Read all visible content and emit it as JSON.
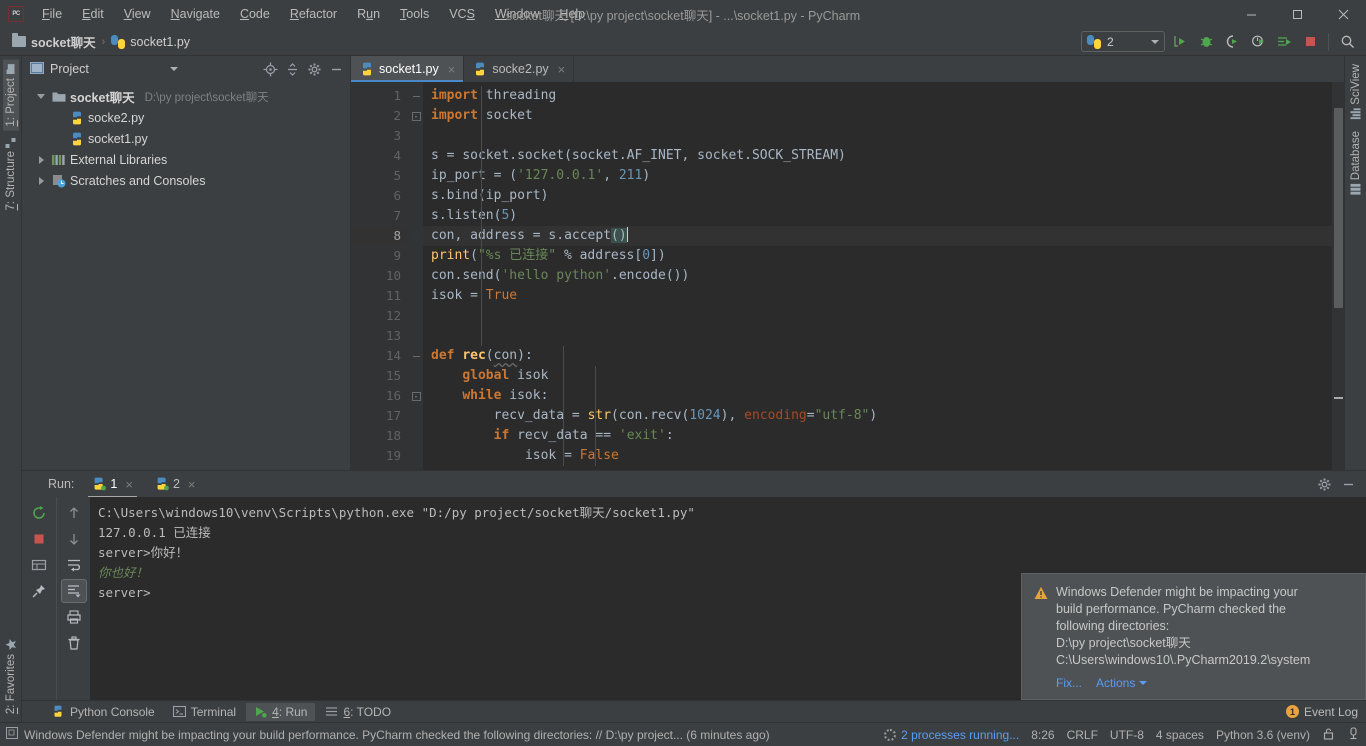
{
  "window": {
    "title": "socket聊天 [D:\\py project\\socket聊天] - ...\\socket1.py - PyCharm",
    "logo_text": "PC",
    "minimize": "—",
    "maximize": "❐",
    "close": "✕"
  },
  "menubar": {
    "items": [
      {
        "label": "File",
        "mnemonic": "F"
      },
      {
        "label": "Edit",
        "mnemonic": "E"
      },
      {
        "label": "View",
        "mnemonic": "V"
      },
      {
        "label": "Navigate",
        "mnemonic": "N"
      },
      {
        "label": "Code",
        "mnemonic": "C"
      },
      {
        "label": "Refactor",
        "mnemonic": "R"
      },
      {
        "label": "Run",
        "mnemonic": "u"
      },
      {
        "label": "Tools",
        "mnemonic": "T"
      },
      {
        "label": "VCS",
        "mnemonic": "S"
      },
      {
        "label": "Window",
        "mnemonic": "W"
      },
      {
        "label": "Help",
        "mnemonic": "H"
      }
    ]
  },
  "breadcrumb": {
    "project": "socket聊天",
    "separator": "›",
    "file": "socket1.py"
  },
  "toolbar": {
    "run_config": "2",
    "icons": [
      {
        "name": "run-icon",
        "glyph": "▶"
      },
      {
        "name": "debug-icon",
        "glyph": "🐞"
      },
      {
        "name": "coverage-icon",
        "glyph": "◗"
      },
      {
        "name": "profile-icon",
        "glyph": "◔"
      },
      {
        "name": "attach-icon",
        "glyph": "≡"
      },
      {
        "name": "stop-icon",
        "glyph": "■"
      },
      {
        "name": "search-icon",
        "glyph": "🔍"
      }
    ]
  },
  "left_strip": {
    "top": [
      {
        "label": "1: Project",
        "mnemonic": "1",
        "active": true
      },
      {
        "label": "7: Structure",
        "mnemonic": "7",
        "active": false
      }
    ],
    "bottom": [
      {
        "label": "2: Favorites",
        "mnemonic": "2",
        "active": false
      }
    ]
  },
  "right_strip": {
    "items": [
      {
        "label": "SciView"
      },
      {
        "label": "Database"
      }
    ]
  },
  "project_panel": {
    "title": "Project",
    "header_icons": [
      {
        "name": "locate-icon",
        "glyph": "⊕"
      },
      {
        "name": "collapse-all-icon",
        "glyph": "⇅"
      },
      {
        "name": "settings-gear-icon",
        "glyph": "✷"
      },
      {
        "name": "hide-panel-icon",
        "glyph": "—"
      }
    ],
    "tree": [
      {
        "label": "socket聊天",
        "path": "D:\\py project\\socket聊天",
        "icon": "folder-icon",
        "expanded": true,
        "depth": 0,
        "bold": true
      },
      {
        "label": "socke2.py",
        "path": "",
        "icon": "python-file-icon",
        "expanded": null,
        "depth": 1,
        "bold": false
      },
      {
        "label": "socket1.py",
        "path": "",
        "icon": "python-file-icon",
        "expanded": null,
        "depth": 1,
        "bold": false
      },
      {
        "label": "External Libraries",
        "path": "",
        "icon": "library-icon",
        "expanded": false,
        "depth": 0,
        "bold": false
      },
      {
        "label": "Scratches and Consoles",
        "path": "",
        "icon": "scratches-icon",
        "expanded": false,
        "depth": 0,
        "bold": false
      }
    ]
  },
  "editor": {
    "tabs": [
      {
        "label": "socket1.py",
        "active": true,
        "icon": "python-file-icon"
      },
      {
        "label": "socke2.py",
        "active": false,
        "icon": "python-file-icon"
      }
    ],
    "current_line": 8,
    "lines": [
      {
        "n": 1,
        "text": "import threading"
      },
      {
        "n": 2,
        "text": "import socket"
      },
      {
        "n": 3,
        "text": ""
      },
      {
        "n": 4,
        "text": "s = socket.socket(socket.AF_INET, socket.SOCK_STREAM)"
      },
      {
        "n": 5,
        "text": "ip_port = ('127.0.0.1', 211)"
      },
      {
        "n": 6,
        "text": "s.bind(ip_port)"
      },
      {
        "n": 7,
        "text": "s.listen(5)"
      },
      {
        "n": 8,
        "text": "con, address = s.accept()"
      },
      {
        "n": 9,
        "text": "print(\"%s 已连接\" % address[0])"
      },
      {
        "n": 10,
        "text": "con.send('hello python'.encode())"
      },
      {
        "n": 11,
        "text": "isok = True"
      },
      {
        "n": 12,
        "text": ""
      },
      {
        "n": 13,
        "text": ""
      },
      {
        "n": 14,
        "text": "def rec(con):"
      },
      {
        "n": 15,
        "text": "    global isok"
      },
      {
        "n": 16,
        "text": "    while isok:"
      },
      {
        "n": 17,
        "text": "        recv_data = str(con.recv(1024), encoding=\"utf-8\")"
      },
      {
        "n": 18,
        "text": "        if recv_data == 'exit':"
      },
      {
        "n": 19,
        "text": "            isok = False"
      }
    ]
  },
  "run_panel": {
    "label": "Run:",
    "tabs": [
      {
        "label": "1",
        "active": true,
        "icon": "python-run-icon"
      },
      {
        "label": "2",
        "active": false,
        "icon": "python-run-icon"
      }
    ],
    "header_icons": [
      {
        "name": "settings-gear-icon",
        "glyph": "✷"
      },
      {
        "name": "hide-panel-icon",
        "glyph": "—"
      }
    ],
    "tools_left": [
      {
        "name": "rerun-icon",
        "glyph": "⟳"
      },
      {
        "name": "stop-icon",
        "glyph": "■"
      },
      {
        "name": "console-icon",
        "glyph": "▤"
      },
      {
        "name": "pin-tab-icon",
        "glyph": "📌"
      }
    ],
    "tools_right": [
      {
        "name": "scroll-up-icon",
        "glyph": "↑"
      },
      {
        "name": "scroll-down-icon",
        "glyph": "↓"
      },
      {
        "name": "soft-wrap-icon",
        "glyph": "⮌"
      },
      {
        "name": "scroll-to-end-icon",
        "glyph": "⇟",
        "selected": true
      },
      {
        "name": "print-icon",
        "glyph": "🖶"
      },
      {
        "name": "clear-all-icon",
        "glyph": "🗑"
      }
    ],
    "console_lines": [
      {
        "text": "C:\\Users\\windows10\\venv\\Scripts\\python.exe \"D:/py project/socket聊天/socket1.py\"",
        "style": "white"
      },
      {
        "text": "127.0.0.1 已连接",
        "style": "white"
      },
      {
        "text": "server>你好！",
        "style": "white"
      },
      {
        "text": "你也好！",
        "style": "green"
      },
      {
        "text": "server>",
        "style": "white"
      }
    ]
  },
  "notification": {
    "icon": "warning-icon",
    "lines": [
      "Windows Defender might be impacting your",
      "build performance. PyCharm checked the",
      "following directories:",
      "D:\\py project\\socket聊天",
      "C:\\Users\\windows10\\.PyCharm2019.2\\system"
    ],
    "fix_label": "Fix...",
    "actions_label": "Actions"
  },
  "bottom_tabs": {
    "items": [
      {
        "label": "Python Console",
        "mnemonic": "",
        "icon": "python-console-icon",
        "active": false
      },
      {
        "label": "Terminal",
        "mnemonic": "",
        "icon": "terminal-icon",
        "active": false
      },
      {
        "label": "4: Run",
        "mnemonic": "4",
        "icon": "run-green-icon",
        "active": true
      },
      {
        "label": "6: TODO",
        "mnemonic": "6",
        "icon": "todo-icon",
        "active": false
      }
    ],
    "event_log": {
      "label": "Event Log",
      "badge": "1"
    }
  },
  "status_bar": {
    "message": "Windows Defender might be impacting your build performance. PyCharm checked the following directories: // D:\\py project... (6 minutes ago)",
    "processes": "2 processes running...",
    "caret_position": "8:26",
    "line_separator": "CRLF",
    "encoding": "UTF-8",
    "indent": "4 spaces",
    "interpreter": "Python 3.6 (venv)"
  },
  "colors": {
    "bg_chrome": "#3c3f41",
    "bg_editor": "#2b2b2b",
    "bg_gutter": "#313335",
    "accent_blue": "#4a88c7",
    "link_blue": "#589df6",
    "keyword_orange": "#cc7832",
    "string_green": "#6a8759",
    "number_blue": "#6897bb",
    "function_yellow": "#ffc66d",
    "identifier": "#a9b7c6",
    "warning_amber": "#e8a33d"
  }
}
